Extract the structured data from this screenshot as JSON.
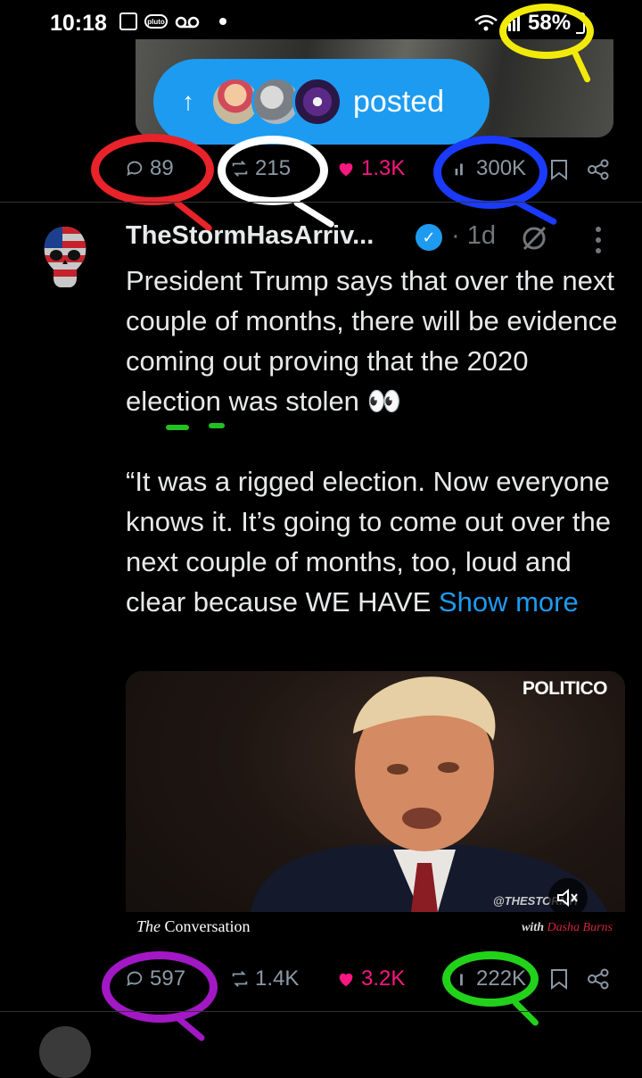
{
  "status_bar": {
    "time": "10:18",
    "battery": "58%",
    "icons": [
      "image-icon",
      "pluto-icon",
      "voicemail-icon",
      "dot-icon",
      "wifi-icon",
      "signal-icon",
      "battery-icon"
    ],
    "pluto_label": "pluto"
  },
  "top_post": {
    "posted_pill": {
      "label": "posted"
    },
    "actions": {
      "replies": "89",
      "reposts": "215",
      "likes": "1.3K",
      "views": "300K"
    }
  },
  "tweet": {
    "author": "TheStormHasArriv...",
    "age": "· 1d",
    "paragraph1": "President Trump says that over the next couple of months, there will be evidence coming out proving that the 2020 election was stolen 👀",
    "paragraph2": "“It was a rigged election. Now everyone knows it. It’s going to come out over the next couple of months, too, loud and clear because WE HAVE",
    "show_more": "Show more",
    "video": {
      "brand": "POLITICO",
      "show_prefix": "The",
      "show_name": "Conversation",
      "with_prefix": "with",
      "host": "Dasha Burns",
      "watermark": "@THESTORMH"
    },
    "actions": {
      "replies": "597",
      "reposts": "1.4K",
      "likes": "3.2K",
      "views": "222K"
    }
  },
  "colors": {
    "accent": "#1d9bf0",
    "like": "#f91880",
    "muted": "#71767b",
    "annotation_red": "#e8232a",
    "annotation_white": "#ffffff",
    "annotation_blue": "#1a3bff",
    "annotation_yellow": "#f2ea0a",
    "annotation_purple": "#a218c4",
    "annotation_green": "#22d21a"
  }
}
